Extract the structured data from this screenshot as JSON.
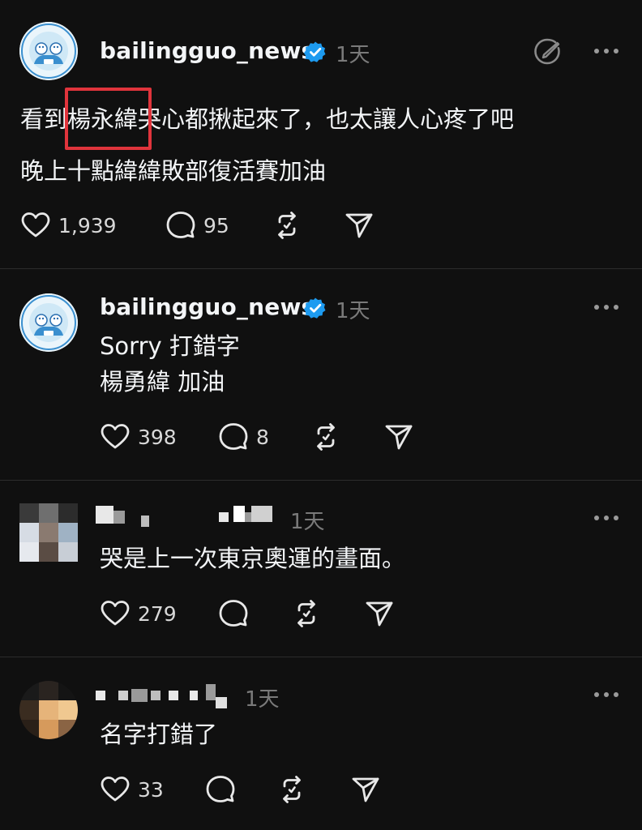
{
  "posts": [
    {
      "username": "bailingguo_news",
      "time": "1天",
      "text_lines": [
        "看到楊永緯哭心都揪起來了，也太讓人心疼了吧",
        "晚上十點緯緯敗部復活賽加油"
      ],
      "likes": "1,939",
      "replies": "95"
    },
    {
      "username": "bailingguo_news",
      "time": "1天",
      "text_lines": [
        "Sorry 打錯字",
        "楊勇緯 加油"
      ],
      "likes": "398",
      "replies": "8"
    },
    {
      "time": "1天",
      "text_lines": [
        "哭是上一次東京奧運的畫面。"
      ],
      "likes": "279"
    },
    {
      "time": "1天",
      "text_lines": [
        "名字打錯了"
      ],
      "likes": "33"
    }
  ],
  "colors": {
    "background": "#101010",
    "highlight": "#e0343c",
    "verified": "#1d9bf0"
  },
  "icons": [
    "heart-icon",
    "comment-icon",
    "repost-icon",
    "share-icon",
    "more-icon",
    "verified-icon",
    "edit-icon"
  ]
}
